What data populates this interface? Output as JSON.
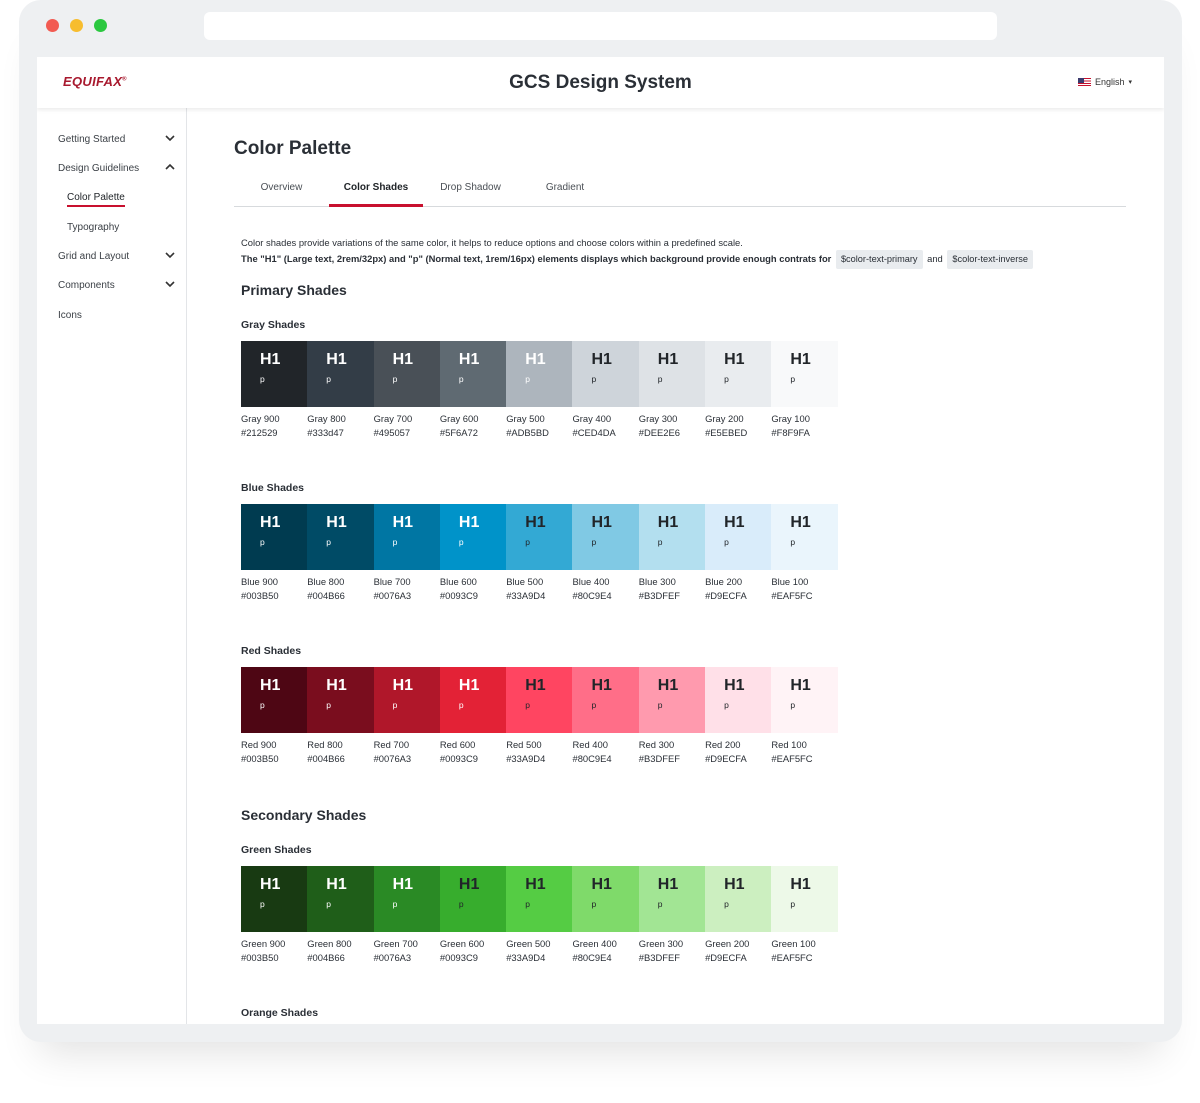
{
  "app": {
    "title": "GCS Design System",
    "logo": "EQUIFAX",
    "logo_mark": "®",
    "language": "English",
    "brand_color": "#c8102e"
  },
  "sidebar": {
    "items": [
      {
        "label": "Getting Started",
        "icon": "chevron-down-icon"
      },
      {
        "label": "Design Guidelines",
        "icon": "chevron-up-icon"
      },
      {
        "label": "Color Palette",
        "active": true
      },
      {
        "label": "Typography"
      },
      {
        "label": "Grid and Layout",
        "icon": "chevron-down-icon"
      },
      {
        "label": "Components",
        "icon": "chevron-down-icon"
      },
      {
        "label": "Icons"
      }
    ]
  },
  "main": {
    "title": "Color Palette",
    "tabs": [
      {
        "label": "Overview"
      },
      {
        "label": "Color Shades",
        "active": true
      },
      {
        "label": "Drop Shadow"
      },
      {
        "label": "Gradient"
      }
    ],
    "intro": {
      "line1": "Color shades provide variations of the same color, it helps to reduce options and choose colors within a predefined scale.",
      "line2": "The \"H1\" (Large text, 2rem/32px) and \"p\" (Normal text, 1rem/16px) elements displays which background provide enough contrats for",
      "chip1": "$color-text-primary",
      "and": "and",
      "chip2": "$color-text-inverse"
    },
    "primary_heading": "Primary Shades",
    "secondary_heading": "Secondary Shades",
    "swatch_h1": "H1",
    "swatch_p": "p",
    "groups": {
      "gray": {
        "title": "Gray Shades",
        "swatches": [
          {
            "name": "Gray 900",
            "hex": "#212529",
            "bg": "#212529",
            "text": "#ffffff"
          },
          {
            "name": "Gray 800",
            "hex": "#333d47",
            "bg": "#333d47",
            "text": "#ffffff"
          },
          {
            "name": "Gray 700",
            "hex": "#495057",
            "bg": "#495057",
            "text": "#ffffff"
          },
          {
            "name": "Gray 600",
            "hex": "#5F6A72",
            "bg": "#5F6A72",
            "text": "#ffffff"
          },
          {
            "name": "Gray 500",
            "hex": "#ADB5BD",
            "bg": "#ADB5BD",
            "text": "#ffffff"
          },
          {
            "name": "Gray 400",
            "hex": "#CED4DA",
            "bg": "#CED4DA",
            "text": "#212529"
          },
          {
            "name": "Gray 300",
            "hex": "#DEE2E6",
            "bg": "#DEE2E6",
            "text": "#212529"
          },
          {
            "name": "Gray 200",
            "hex": "#E5EBED",
            "bg": "#E9ECEF",
            "text": "#212529"
          },
          {
            "name": "Gray 100",
            "hex": "#F8F9FA",
            "bg": "#F8F9FA",
            "text": "#212529"
          }
        ]
      },
      "blue": {
        "title": "Blue Shades",
        "swatches": [
          {
            "name": "Blue 900",
            "hex": "#003B50",
            "bg": "#003B50",
            "text": "#ffffff"
          },
          {
            "name": "Blue 800",
            "hex": "#004B66",
            "bg": "#004B66",
            "text": "#ffffff"
          },
          {
            "name": "Blue 700",
            "hex": "#0076A3",
            "bg": "#0076A3",
            "text": "#ffffff"
          },
          {
            "name": "Blue 600",
            "hex": "#0093C9",
            "bg": "#0093C9",
            "text": "#ffffff"
          },
          {
            "name": "Blue 500",
            "hex": "#33A9D4",
            "bg": "#33A9D4",
            "text": "#212529"
          },
          {
            "name": "Blue 400",
            "hex": "#80C9E4",
            "bg": "#80C9E4",
            "text": "#212529"
          },
          {
            "name": "Blue 300",
            "hex": "#B3DFEF",
            "bg": "#B3DFEF",
            "text": "#212529"
          },
          {
            "name": "Blue 200",
            "hex": "#D9ECFA",
            "bg": "#D9ECFA",
            "text": "#212529"
          },
          {
            "name": "Blue 100",
            "hex": "#EAF5FC",
            "bg": "#EAF5FC",
            "text": "#212529"
          }
        ]
      },
      "red": {
        "title": "Red Shades",
        "swatches": [
          {
            "name": "Red 900",
            "hex": "#003B50",
            "bg": "#4E0614",
            "text": "#ffffff"
          },
          {
            "name": "Red 800",
            "hex": "#004B66",
            "bg": "#7A0D1E",
            "text": "#ffffff"
          },
          {
            "name": "Red 700",
            "hex": "#0076A3",
            "bg": "#B0172A",
            "text": "#ffffff"
          },
          {
            "name": "Red 600",
            "hex": "#0093C9",
            "bg": "#E32236",
            "text": "#ffffff"
          },
          {
            "name": "Red 500",
            "hex": "#33A9D4",
            "bg": "#FF4561",
            "text": "#212529"
          },
          {
            "name": "Red 400",
            "hex": "#80C9E4",
            "bg": "#FF6E88",
            "text": "#212529"
          },
          {
            "name": "Red 300",
            "hex": "#B3DFEF",
            "bg": "#FF9AAE",
            "text": "#212529"
          },
          {
            "name": "Red 200",
            "hex": "#D9ECFA",
            "bg": "#FFE0E8",
            "text": "#212529"
          },
          {
            "name": "Red 100",
            "hex": "#EAF5FC",
            "bg": "#FFF3F6",
            "text": "#212529"
          }
        ]
      },
      "green": {
        "title": "Green Shades",
        "swatches": [
          {
            "name": "Green 900",
            "hex": "#003B50",
            "bg": "#183A12",
            "text": "#ffffff"
          },
          {
            "name": "Green 800",
            "hex": "#004B66",
            "bg": "#1F5E19",
            "text": "#ffffff"
          },
          {
            "name": "Green 700",
            "hex": "#0076A3",
            "bg": "#2A8A25",
            "text": "#ffffff"
          },
          {
            "name": "Green 600",
            "hex": "#0093C9",
            "bg": "#37AD2D",
            "text": "#212529"
          },
          {
            "name": "Green 500",
            "hex": "#33A9D4",
            "bg": "#55CC44",
            "text": "#212529"
          },
          {
            "name": "Green 400",
            "hex": "#80C9E4",
            "bg": "#7FDA6A",
            "text": "#212529"
          },
          {
            "name": "Green 300",
            "hex": "#B3DFEF",
            "bg": "#A2E594",
            "text": "#212529"
          },
          {
            "name": "Green 200",
            "hex": "#D9ECFA",
            "bg": "#CCEFC0",
            "text": "#212529"
          },
          {
            "name": "Green 100",
            "hex": "#EAF5FC",
            "bg": "#EDF9E8",
            "text": "#212529"
          }
        ]
      },
      "orange": {
        "title": "Orange Shades"
      }
    }
  }
}
